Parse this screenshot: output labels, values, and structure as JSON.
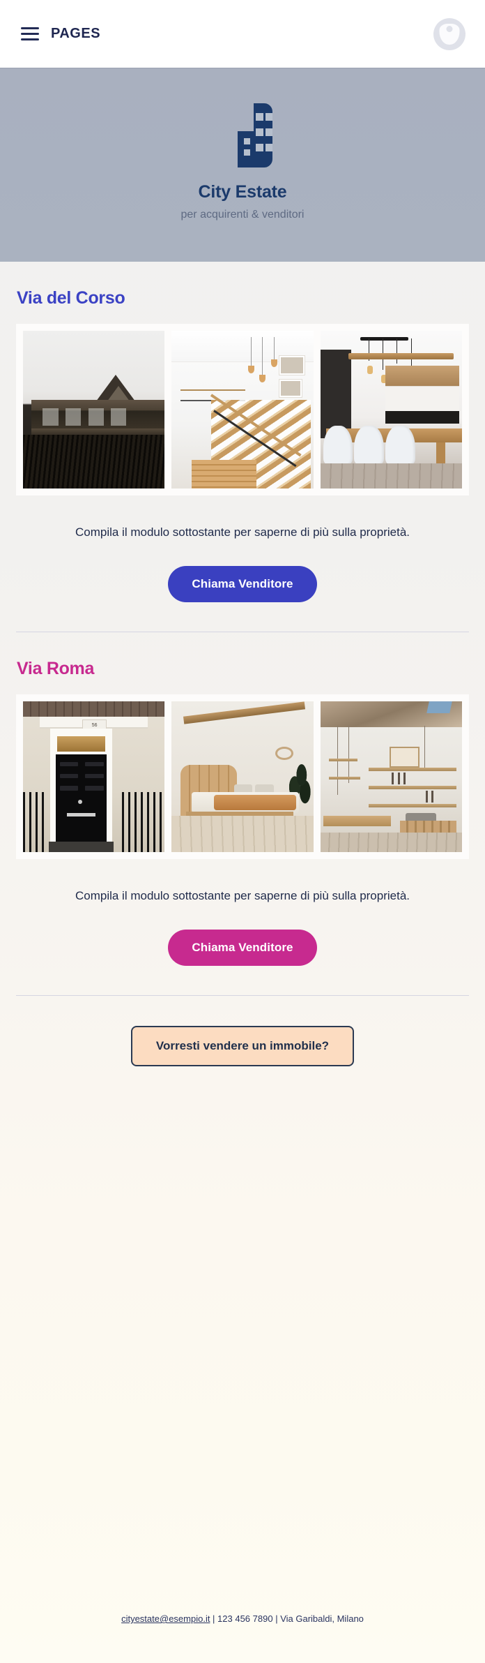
{
  "topbar": {
    "menu_icon": "hamburger-menu-icon",
    "brand": "PAGES",
    "avatar_icon": "user-avatar-icon"
  },
  "hero": {
    "logo_icon": "buildings-logo-icon",
    "title": "City Estate",
    "subtitle": "per acquirenti & venditori",
    "bg_color": "#a9b1c0",
    "logo_color": "#1b3a6b"
  },
  "sections": [
    {
      "title": "Via del Corso",
      "title_color": "#3b42c4",
      "photos": [
        "modern-timber-house-exterior",
        "white-interior-staircase",
        "dining-table-kitchen"
      ],
      "blurb": "Compila il modulo sottostante per saperne di più sulla proprietà.",
      "cta_label": "Chiama Venditore",
      "cta_color": "#3a40c0"
    },
    {
      "title": "Via Roma",
      "title_color": "#c72a8f",
      "photos": [
        "black-townhouse-door",
        "boho-bedroom",
        "loft-workshop-shelves"
      ],
      "blurb": "Compila il modulo sottostante per saperne di più sulla proprietà.",
      "cta_label": "Chiama Venditore",
      "cta_color": "#c72a8f"
    }
  ],
  "sell": {
    "label": "Vorresti vendere un immobile?",
    "bg_color": "#fcdcc1",
    "border_color": "#2b3a52"
  },
  "footer": {
    "email": "cityestate@esempio.it",
    "sep1": " | ",
    "phone": "123 456 7890",
    "sep2": " | ",
    "address": "Via Garibaldi, Milano"
  },
  "photo_details": {
    "door_number": "56"
  }
}
